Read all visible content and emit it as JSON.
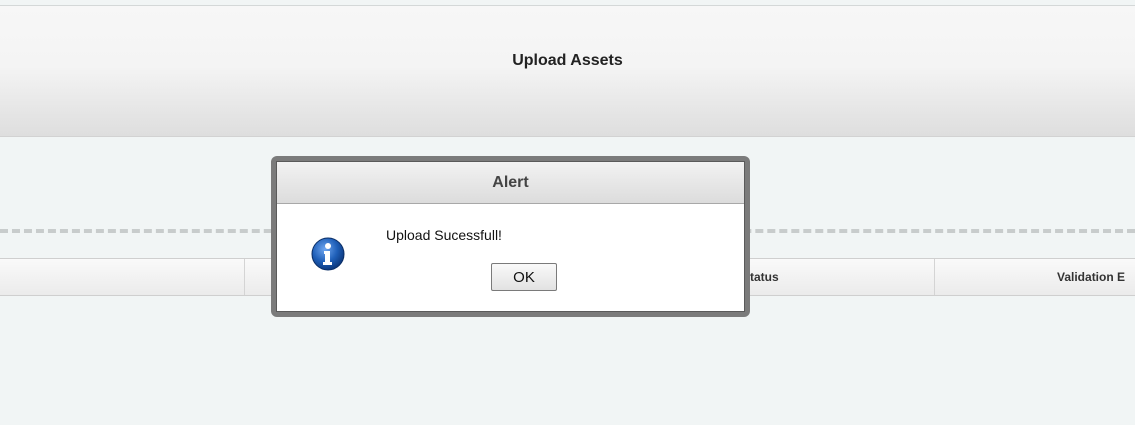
{
  "header": {
    "title": "Upload Assets"
  },
  "table": {
    "columns": [
      "",
      "Status",
      "Validation E"
    ]
  },
  "alert": {
    "title": "Alert",
    "message": "Upload Sucessfull!",
    "ok_label": "OK",
    "icon": "info-icon"
  },
  "colors": {
    "background": "#f1f5f5",
    "dialog_frame": "#7b7b7b",
    "info_icon_blue": "#1f5fb8"
  }
}
